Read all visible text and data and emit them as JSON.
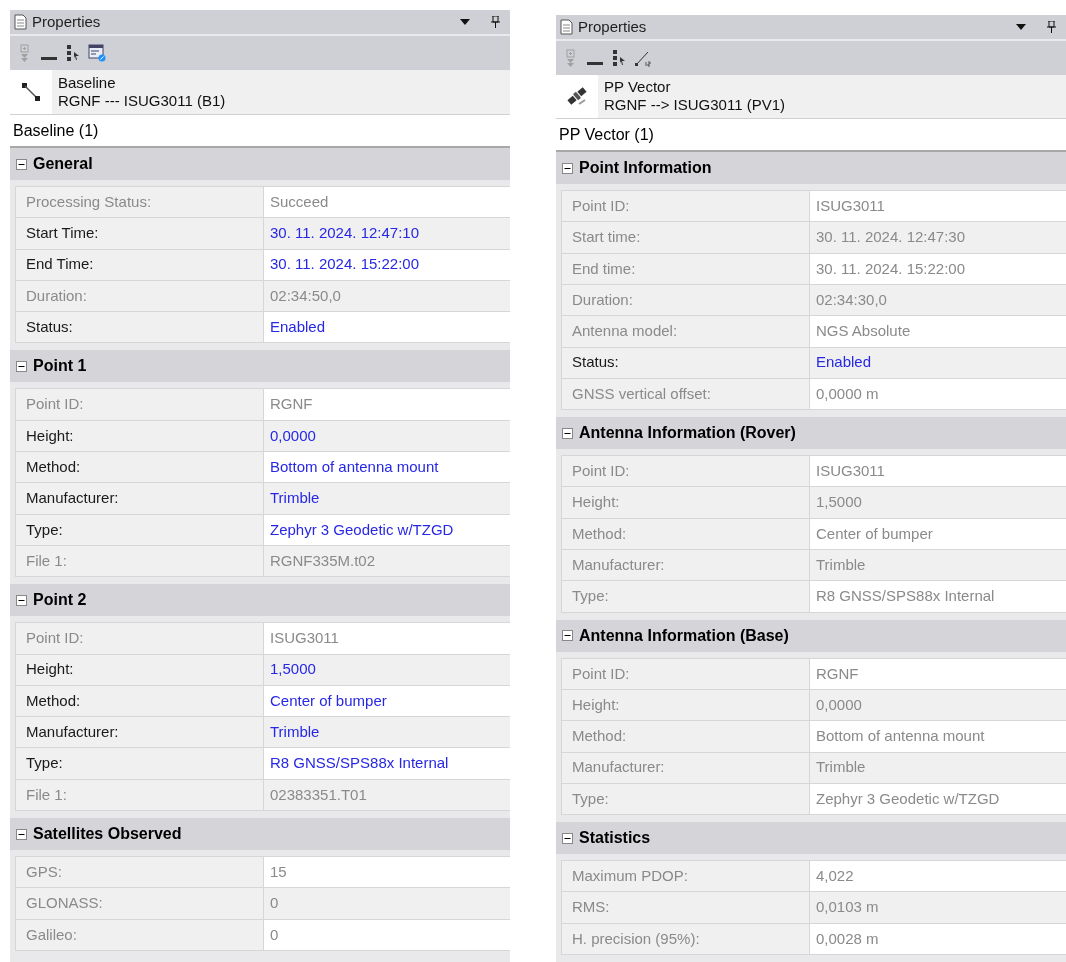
{
  "panels": [
    {
      "title": "Properties",
      "toolbar": [
        {
          "kind": "expand",
          "disabled": true
        },
        {
          "kind": "collapse",
          "disabled": false
        },
        {
          "kind": "select",
          "disabled": false
        },
        {
          "kind": "edit",
          "disabled": false
        }
      ],
      "object": {
        "kind": "baseline",
        "name": "Baseline",
        "detail": "RGNF --- ISUG3011 (B1)"
      },
      "selector": "Baseline (1)",
      "sections": [
        {
          "title": "General",
          "expanded": true,
          "rows": [
            {
              "label": "Processing Status:",
              "value": "Succeed",
              "editable": false
            },
            {
              "label": "Start Time:",
              "value": "30. 11. 2024. 12:47:10",
              "editable": true
            },
            {
              "label": "End Time:",
              "value": "30. 11. 2024. 15:22:00",
              "editable": true
            },
            {
              "label": "Duration:",
              "value": "02:34:50,0",
              "editable": false
            },
            {
              "label": "Status:",
              "value": "Enabled",
              "editable": true
            }
          ]
        },
        {
          "title": "Point 1",
          "expanded": true,
          "rows": [
            {
              "label": "Point ID:",
              "value": "RGNF",
              "editable": false
            },
            {
              "label": "Height:",
              "value": "0,0000",
              "editable": true
            },
            {
              "label": "Method:",
              "value": "Bottom of antenna mount",
              "editable": true
            },
            {
              "label": "Manufacturer:",
              "value": "Trimble",
              "editable": true
            },
            {
              "label": "Type:",
              "value": "Zephyr 3 Geodetic w/TZGD",
              "editable": true
            },
            {
              "label": "File 1:",
              "value": "RGNF335M.t02",
              "editable": false
            }
          ]
        },
        {
          "title": "Point 2",
          "expanded": true,
          "rows": [
            {
              "label": "Point ID:",
              "value": "ISUG3011",
              "editable": false
            },
            {
              "label": "Height:",
              "value": "1,5000",
              "editable": true
            },
            {
              "label": "Method:",
              "value": "Center of bumper",
              "editable": true
            },
            {
              "label": "Manufacturer:",
              "value": "Trimble",
              "editable": true
            },
            {
              "label": "Type:",
              "value": "R8 GNSS/SPS88x Internal",
              "editable": true
            },
            {
              "label": "File 1:",
              "value": "02383351.T01",
              "editable": false
            }
          ]
        },
        {
          "title": "Satellites Observed",
          "expanded": true,
          "rows": [
            {
              "label": "GPS:",
              "value": "15",
              "editable": false
            },
            {
              "label": "GLONASS:",
              "value": "0",
              "editable": false
            },
            {
              "label": "Galileo:",
              "value": "0",
              "editable": false
            }
          ]
        }
      ]
    },
    {
      "title": "Properties",
      "toolbar": [
        {
          "kind": "expand",
          "disabled": true
        },
        {
          "kind": "collapse",
          "disabled": false
        },
        {
          "kind": "select",
          "disabled": false
        },
        {
          "kind": "vector",
          "disabled": false
        }
      ],
      "object": {
        "kind": "vector",
        "name": "PP Vector",
        "detail": "RGNF --> ISUG3011 (PV1)"
      },
      "selector": "PP Vector (1)",
      "sections": [
        {
          "title": "Point Information",
          "expanded": true,
          "rows": [
            {
              "label": "Point ID:",
              "value": "ISUG3011",
              "editable": false
            },
            {
              "label": "Start time:",
              "value": "30. 11. 2024. 12:47:30",
              "editable": false
            },
            {
              "label": "End time:",
              "value": "30. 11. 2024. 15:22:00",
              "editable": false
            },
            {
              "label": "Duration:",
              "value": "02:34:30,0",
              "editable": false
            },
            {
              "label": "Antenna model:",
              "value": "NGS Absolute",
              "editable": false
            },
            {
              "label": "Status:",
              "value": "Enabled",
              "editable": true
            },
            {
              "label": "GNSS vertical offset:",
              "value": "0,0000 m",
              "editable": false
            }
          ]
        },
        {
          "title": "Antenna Information (Rover)",
          "expanded": true,
          "rows": [
            {
              "label": "Point ID:",
              "value": "ISUG3011",
              "editable": false
            },
            {
              "label": "Height:",
              "value": "1,5000",
              "editable": false
            },
            {
              "label": "Method:",
              "value": "Center of bumper",
              "editable": false
            },
            {
              "label": "Manufacturer:",
              "value": "Trimble",
              "editable": false
            },
            {
              "label": "Type:",
              "value": "R8 GNSS/SPS88x Internal",
              "editable": false
            }
          ]
        },
        {
          "title": "Antenna Information (Base)",
          "expanded": true,
          "rows": [
            {
              "label": "Point ID:",
              "value": "RGNF",
              "editable": false
            },
            {
              "label": "Height:",
              "value": "0,0000",
              "editable": false
            },
            {
              "label": "Method:",
              "value": "Bottom of antenna mount",
              "editable": false
            },
            {
              "label": "Manufacturer:",
              "value": "Trimble",
              "editable": false
            },
            {
              "label": "Type:",
              "value": "Zephyr 3 Geodetic w/TZGD",
              "editable": false
            }
          ]
        },
        {
          "title": "Statistics",
          "expanded": true,
          "rows": [
            {
              "label": "Maximum PDOP:",
              "value": "4,022",
              "editable": false
            },
            {
              "label": "RMS:",
              "value": "0,0103 m",
              "editable": false
            },
            {
              "label": "H. precision (95%):",
              "value": "0,0028 m",
              "editable": false
            }
          ]
        }
      ]
    }
  ]
}
